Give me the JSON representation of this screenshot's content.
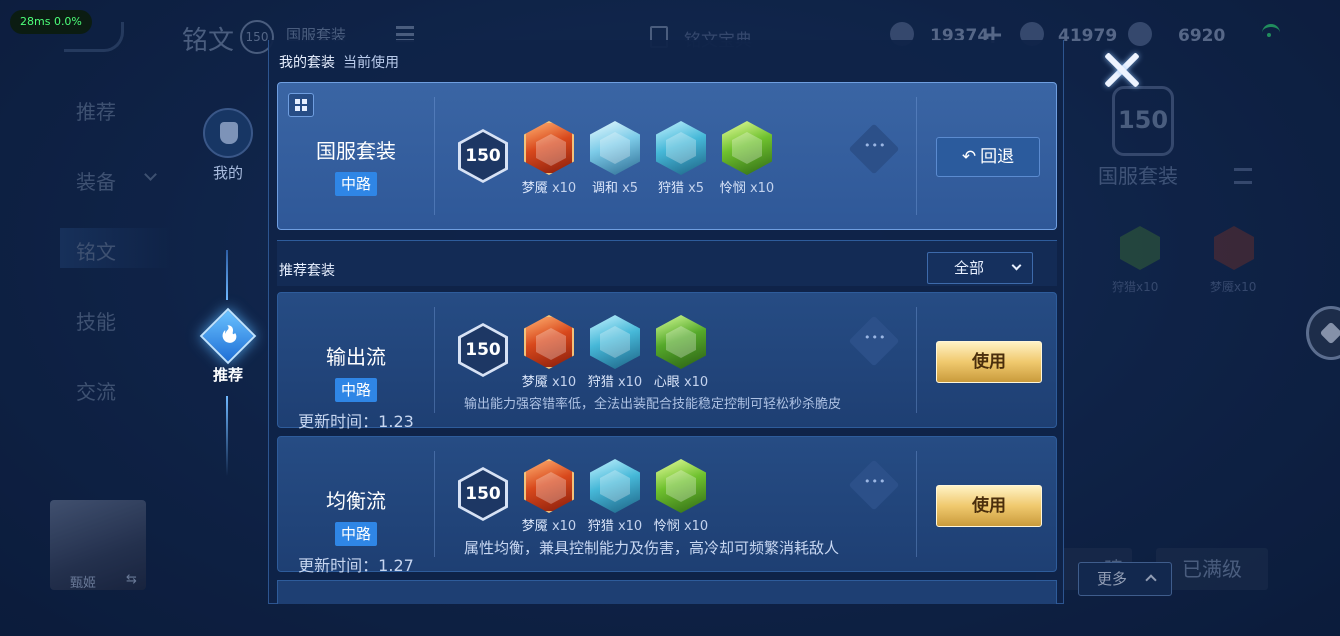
{
  "overlay": {
    "fps": "28ms  0.0%"
  },
  "background": {
    "title": "铭文",
    "level": "150",
    "set_name": "国服套装",
    "doc_label": "铭文宝典",
    "currencies": [
      {
        "value": "19374",
        "icon": "coin-icon"
      },
      {
        "value": "41979",
        "icon": "voucher-icon"
      },
      {
        "value": "6920",
        "icon": "diamond-icon"
      }
    ],
    "nav": [
      "推荐",
      "装备",
      "铭文",
      "技能",
      "交流"
    ],
    "right_level": "150",
    "right_set_name": "国服套装",
    "right_rune_labels": [
      "狩猎x10",
      "梦魇x10"
    ],
    "avatar_name": "甄姬",
    "build_label": "建",
    "maxed_label": "已满级",
    "more_label": "更多"
  },
  "side_tabs": {
    "mine": "我的",
    "recommend": "推荐"
  },
  "my_sets": {
    "heading": "我的套装",
    "sub": "当前使用",
    "current": {
      "name": "国服套装",
      "lane": "中路",
      "level": "150",
      "runes": [
        {
          "name": "梦魇",
          "count": "x10",
          "color": "#d8481c"
        },
        {
          "name": "调和",
          "count": "x5",
          "color": "#7ccbe8"
        },
        {
          "name": "狩猎",
          "count": "x5",
          "color": "#46b8d8"
        },
        {
          "name": "怜悯",
          "count": "x10",
          "color": "#6fc12e"
        }
      ],
      "action": "回退"
    }
  },
  "recommended": {
    "heading": "推荐套装",
    "filter": "全部",
    "sets": [
      {
        "name": "输出流",
        "lane": "中路",
        "updated": "更新时间：1.23",
        "level": "150",
        "runes": [
          {
            "name": "梦魇",
            "count": "x10"
          },
          {
            "name": "狩猎",
            "count": "x10"
          },
          {
            "name": "心眼",
            "count": "x10"
          }
        ],
        "desc": "输出能力强容错率低，全法出装配合技能稳定控制可轻松秒杀脆皮",
        "action": "使用"
      },
      {
        "name": "均衡流",
        "lane": "中路",
        "updated": "更新时间：1.27",
        "level": "150",
        "runes": [
          {
            "name": "梦魇",
            "count": "x10"
          },
          {
            "name": "狩猎",
            "count": "x10"
          },
          {
            "name": "怜悯",
            "count": "x10"
          }
        ],
        "desc": "属性均衡，兼具控制能力及伤害，高冷却可频繁消耗敌人",
        "action": "使用"
      }
    ]
  }
}
